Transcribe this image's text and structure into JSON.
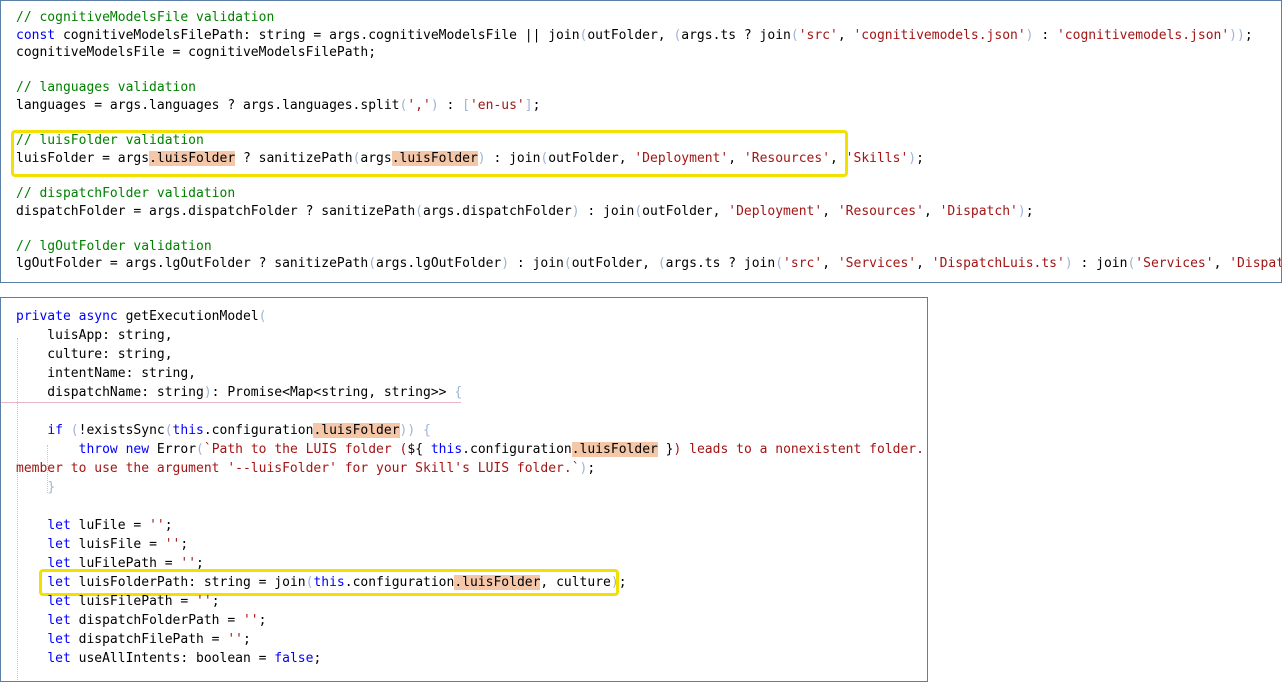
{
  "panel1": {
    "lines": [
      [
        {
          "t": "// cognitiveModelsFile validation",
          "c": "cm"
        }
      ],
      [
        {
          "t": "const",
          "c": "kw"
        },
        {
          "t": " cognitiveModelsFilePath: string = args.cognitiveModelsFile || join"
        },
        {
          "t": "(",
          "c": "br"
        },
        {
          "t": "outFolder, "
        },
        {
          "t": "(",
          "c": "br"
        },
        {
          "t": "args.ts ? join"
        },
        {
          "t": "(",
          "c": "br"
        },
        {
          "t": "'src'",
          "c": "str"
        },
        {
          "t": ", "
        },
        {
          "t": "'cognitivemodels.json'",
          "c": "str"
        },
        {
          "t": ")",
          "c": "br"
        },
        {
          "t": " : "
        },
        {
          "t": "'cognitivemodels.json'",
          "c": "str"
        },
        {
          "t": "))",
          "c": "br"
        },
        {
          "t": ";"
        }
      ],
      [
        {
          "t": "cognitiveModelsFile = cognitiveModelsFilePath;"
        }
      ],
      [],
      [
        {
          "t": "// languages validation",
          "c": "cm"
        }
      ],
      [
        {
          "t": "languages = args.languages ? args.languages.split"
        },
        {
          "t": "(",
          "c": "br"
        },
        {
          "t": "','",
          "c": "str"
        },
        {
          "t": ")",
          "c": "br"
        },
        {
          "t": " : "
        },
        {
          "t": "[",
          "c": "br"
        },
        {
          "t": "'en-us'",
          "c": "str"
        },
        {
          "t": "]",
          "c": "br"
        },
        {
          "t": ";"
        }
      ],
      [],
      [
        {
          "t": "// luisFolder validation",
          "c": "cm"
        }
      ],
      [
        {
          "t": "luisFolder = args"
        },
        {
          "t": ".luisFolder",
          "c": "hl"
        },
        {
          "t": " ? sanitizePath"
        },
        {
          "t": "(",
          "c": "br"
        },
        {
          "t": "args"
        },
        {
          "t": ".luisFolder",
          "c": "hl"
        },
        {
          "t": ")",
          "c": "br"
        },
        {
          "t": " : join"
        },
        {
          "t": "(",
          "c": "br"
        },
        {
          "t": "outFolder, "
        },
        {
          "t": "'Deployment'",
          "c": "str"
        },
        {
          "t": ", "
        },
        {
          "t": "'Resources'",
          "c": "str"
        },
        {
          "t": ", "
        },
        {
          "t": "'Skills'",
          "c": "str"
        },
        {
          "t": ")",
          "c": "br"
        },
        {
          "t": ";"
        }
      ],
      [],
      [
        {
          "t": "// dispatchFolder validation",
          "c": "cm"
        }
      ],
      [
        {
          "t": "dispatchFolder = args.dispatchFolder ? sanitizePath"
        },
        {
          "t": "(",
          "c": "br"
        },
        {
          "t": "args.dispatchFolder"
        },
        {
          "t": ")",
          "c": "br"
        },
        {
          "t": " : join"
        },
        {
          "t": "(",
          "c": "br"
        },
        {
          "t": "outFolder, "
        },
        {
          "t": "'Deployment'",
          "c": "str"
        },
        {
          "t": ", "
        },
        {
          "t": "'Resources'",
          "c": "str"
        },
        {
          "t": ", "
        },
        {
          "t": "'Dispatch'",
          "c": "str"
        },
        {
          "t": ")",
          "c": "br"
        },
        {
          "t": ";"
        }
      ],
      [],
      [
        {
          "t": "// lgOutFolder validation",
          "c": "cm"
        }
      ],
      [
        {
          "t": "lgOutFolder = args.lgOutFolder ? sanitizePath"
        },
        {
          "t": "(",
          "c": "br"
        },
        {
          "t": "args.lgOutFolder"
        },
        {
          "t": ")",
          "c": "br"
        },
        {
          "t": " : join"
        },
        {
          "t": "(",
          "c": "br"
        },
        {
          "t": "outFolder, "
        },
        {
          "t": "(",
          "c": "br"
        },
        {
          "t": "args.ts ? join"
        },
        {
          "t": "(",
          "c": "br"
        },
        {
          "t": "'src'",
          "c": "str"
        },
        {
          "t": ", "
        },
        {
          "t": "'Services'",
          "c": "str"
        },
        {
          "t": ", "
        },
        {
          "t": "'DispatchLuis.ts'",
          "c": "str"
        },
        {
          "t": ")",
          "c": "br"
        },
        {
          "t": " : join"
        },
        {
          "t": "(",
          "c": "br"
        },
        {
          "t": "'Services'",
          "c": "str"
        },
        {
          "t": ", "
        },
        {
          "t": "'DispatchLuis.cs'",
          "c": "str"
        },
        {
          "t": ")))",
          "c": "br"
        },
        {
          "t": ";"
        }
      ]
    ]
  },
  "panel2": {
    "lines": [
      [
        {
          "t": "private",
          "c": "kw"
        },
        {
          "t": " "
        },
        {
          "t": "async",
          "c": "kw"
        },
        {
          "t": " getExecutionModel"
        },
        {
          "t": "(",
          "c": "br"
        }
      ],
      [
        {
          "t": "    luisApp: string,"
        }
      ],
      [
        {
          "t": "    culture: string,"
        }
      ],
      [
        {
          "t": "    intentName: string,"
        }
      ],
      [
        {
          "t": "    dispatchName: string"
        },
        {
          "t": ")",
          "c": "br"
        },
        {
          "t": ": Promise<Map<string, string>> "
        },
        {
          "t": "{",
          "c": "br"
        }
      ],
      [],
      [
        {
          "t": "    "
        },
        {
          "t": "if",
          "c": "kw"
        },
        {
          "t": " "
        },
        {
          "t": "(",
          "c": "br"
        },
        {
          "t": "!existsSync"
        },
        {
          "t": "(",
          "c": "br"
        },
        {
          "t": "this",
          "c": "kw"
        },
        {
          "t": ".configuration"
        },
        {
          "t": ".luisFolder",
          "c": "hl"
        },
        {
          "t": "))",
          "c": "br"
        },
        {
          "t": " "
        },
        {
          "t": "{",
          "c": "br"
        }
      ],
      [
        {
          "t": "        "
        },
        {
          "t": "throw",
          "c": "kw"
        },
        {
          "t": " "
        },
        {
          "t": "new",
          "c": "kw"
        },
        {
          "t": " Error"
        },
        {
          "t": "(",
          "c": "br"
        },
        {
          "t": "`Path to the LUIS folder (",
          "c": "str"
        },
        {
          "t": "${ "
        },
        {
          "t": "this",
          "c": "kw"
        },
        {
          "t": ".configuration"
        },
        {
          "t": ".luisFolder",
          "c": "hl"
        },
        {
          "t": " }"
        },
        {
          "t": ") leads to a nonexistent folder.",
          "c": "str"
        }
      ],
      [
        {
          "t": "member to use the argument '--luisFolder' for your Skill's LUIS folder.`",
          "c": "str"
        },
        {
          "t": ")",
          "c": "br"
        },
        {
          "t": ";"
        }
      ],
      [
        {
          "t": "    "
        },
        {
          "t": "}",
          "c": "br"
        }
      ],
      [],
      [
        {
          "t": "    "
        },
        {
          "t": "let",
          "c": "kw"
        },
        {
          "t": " luFile = "
        },
        {
          "t": "''",
          "c": "str"
        },
        {
          "t": ";"
        }
      ],
      [
        {
          "t": "    "
        },
        {
          "t": "let",
          "c": "kw"
        },
        {
          "t": " luisFile = "
        },
        {
          "t": "''",
          "c": "str"
        },
        {
          "t": ";"
        }
      ],
      [
        {
          "t": "    "
        },
        {
          "t": "let",
          "c": "kw"
        },
        {
          "t": " luFilePath = "
        },
        {
          "t": "''",
          "c": "str"
        },
        {
          "t": ";"
        }
      ],
      [
        {
          "t": "    "
        },
        {
          "t": "let",
          "c": "kw"
        },
        {
          "t": " luisFolderPath: string = join"
        },
        {
          "t": "(",
          "c": "br"
        },
        {
          "t": "this",
          "c": "kw"
        },
        {
          "t": ".configuration"
        },
        {
          "t": ".luisFolder",
          "c": "hl"
        },
        {
          "t": ", culture"
        },
        {
          "t": ")",
          "c": "br"
        },
        {
          "t": ";"
        }
      ],
      [
        {
          "t": "    "
        },
        {
          "t": "let",
          "c": "kw"
        },
        {
          "t": " luisFilePath = "
        },
        {
          "t": "''",
          "c": "str"
        },
        {
          "t": ";"
        }
      ],
      [
        {
          "t": "    "
        },
        {
          "t": "let",
          "c": "kw"
        },
        {
          "t": " dispatchFolderPath = "
        },
        {
          "t": "''",
          "c": "str"
        },
        {
          "t": ";"
        }
      ],
      [
        {
          "t": "    "
        },
        {
          "t": "let",
          "c": "kw"
        },
        {
          "t": " dispatchFilePath = "
        },
        {
          "t": "''",
          "c": "str"
        },
        {
          "t": ";"
        }
      ],
      [
        {
          "t": "    "
        },
        {
          "t": "let",
          "c": "kw"
        },
        {
          "t": " useAllIntents: boolean = "
        },
        {
          "t": "false",
          "c": "kw"
        },
        {
          "t": ";"
        }
      ]
    ]
  }
}
